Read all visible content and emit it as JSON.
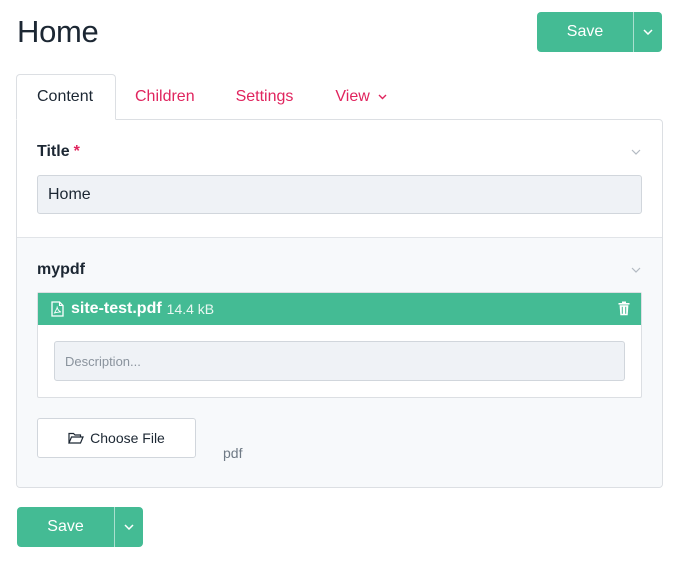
{
  "page": {
    "title": "Home"
  },
  "save": {
    "label": "Save"
  },
  "tabs": [
    {
      "label": "Content"
    },
    {
      "label": "Children"
    },
    {
      "label": "Settings"
    },
    {
      "label": "View"
    }
  ],
  "fields": {
    "title": {
      "label": "Title",
      "required_mark": "*",
      "value": "Home"
    },
    "mypdf": {
      "label": "mypdf",
      "file_name": "site-test.pdf",
      "file_size": "14.4 kB",
      "description_placeholder": "Description...",
      "choose_file_label": "Choose File",
      "accept": "pdf"
    }
  },
  "colors": {
    "accent": "#44bb94",
    "link": "#e0245e",
    "text": "#1c2733"
  },
  "icons": {
    "save_dropdown": "chevron-down-icon",
    "tab_dropdown": "chevron-down-icon",
    "collapse": "chevron-down-icon",
    "file": "pdf-file-icon",
    "delete": "trash-icon",
    "choose": "folder-open-icon"
  }
}
